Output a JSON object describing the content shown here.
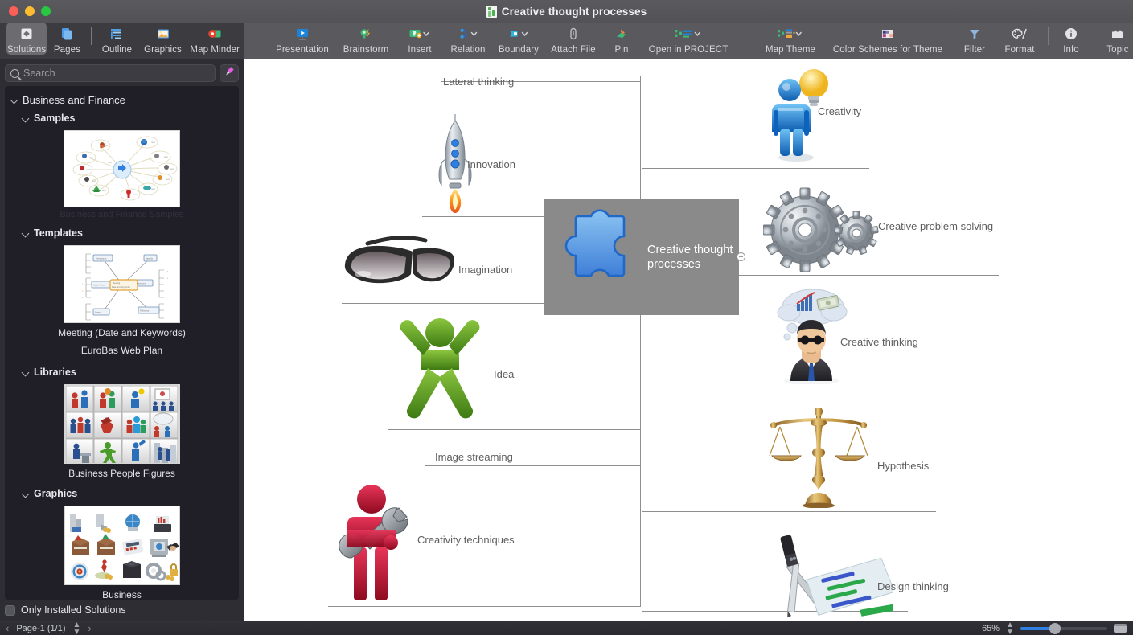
{
  "window": {
    "title": "Creative thought processes",
    "title_icon": "document-icon",
    "traffic_lights": [
      "close",
      "minimize",
      "zoom"
    ]
  },
  "toolbar": {
    "left_group": [
      {
        "label": "Solutions",
        "icon": "solutions-icon",
        "selected": true,
        "chevron": false
      },
      {
        "label": "Pages",
        "icon": "pages-icon",
        "selected": false,
        "chevron": false
      },
      {
        "label": "Outline",
        "icon": "outline-icon",
        "selected": false,
        "chevron": false
      },
      {
        "label": "Graphics",
        "icon": "graphics-icon",
        "selected": false,
        "chevron": false
      },
      {
        "label": "Map Minder",
        "icon": "map-minder-icon",
        "selected": false,
        "chevron": false
      }
    ],
    "right_group": [
      {
        "label": "Presentation",
        "icon": "presentation-icon",
        "chevron": false
      },
      {
        "label": "Brainstorm",
        "icon": "brainstorm-icon",
        "chevron": false
      },
      {
        "label": "Insert",
        "icon": "insert-icon",
        "chevron": true
      },
      {
        "label": "Relation",
        "icon": "relation-icon",
        "chevron": true
      },
      {
        "label": "Boundary",
        "icon": "boundary-icon",
        "chevron": true
      },
      {
        "label": "Attach File",
        "icon": "attach-file-icon",
        "chevron": false
      },
      {
        "label": "Pin",
        "icon": "pin-icon",
        "chevron": false
      },
      {
        "label": "Open in PROJECT",
        "icon": "open-in-project-icon",
        "chevron": true
      },
      {
        "label": "Map Theme",
        "icon": "map-theme-icon",
        "chevron": true
      },
      {
        "label": "Color Schemes for Theme",
        "icon": "color-schemes-icon",
        "chevron": false
      },
      {
        "label": "Filter",
        "icon": "filter-icon",
        "chevron": false
      },
      {
        "label": "Format",
        "icon": "format-icon",
        "chevron": false
      },
      {
        "label": "Info",
        "icon": "info-icon",
        "chevron": false
      },
      {
        "label": "Topic",
        "icon": "topic-icon",
        "chevron": false
      }
    ]
  },
  "sidebar": {
    "search": {
      "placeholder": "Search",
      "icon": "search-icon",
      "value": ""
    },
    "stamp_button_icon": "stamp-icon",
    "root": {
      "label": "Business and Finance",
      "expanded": true
    },
    "groups": [
      {
        "label": "Samples",
        "expanded": true,
        "items": [
          {
            "caption": "Business and Finance Samples",
            "thumbnail": "radial-mindmap-thumbnail"
          }
        ]
      },
      {
        "label": "Templates",
        "expanded": true,
        "items": [
          {
            "caption": "Meeting (Date and Keywords)",
            "thumbnail": "meeting-template-thumbnail"
          },
          {
            "caption": "EuroBas Web Plan",
            "thumbnail": null
          }
        ]
      },
      {
        "label": "Libraries",
        "expanded": true,
        "items": [
          {
            "caption": "Business People Figures",
            "thumbnail": "people-figures-grid-thumbnail"
          }
        ]
      },
      {
        "label": "Graphics",
        "expanded": true,
        "items": [
          {
            "caption": "Business",
            "thumbnail": "business-graphics-grid-thumbnail"
          }
        ]
      }
    ],
    "only_installed": {
      "label": "Only Installed Solutions",
      "checked": false
    }
  },
  "mindmap": {
    "central": {
      "text": "Creative thought\nprocesses",
      "icon": "puzzle-piece-icon",
      "fill": "#8a8a8a"
    },
    "left_branches": [
      {
        "label": "Lateral thinking",
        "icon": null
      },
      {
        "label": "Innovation",
        "icon": "rocket-icon"
      },
      {
        "label": "Imagination",
        "icon": "sunglasses-icon"
      },
      {
        "label": "Idea",
        "icon": "green-figure-icon"
      },
      {
        "label": "Image streaming",
        "icon": null
      },
      {
        "label": "Creativity techniques",
        "icon": "red-figure-wrench-icon"
      }
    ],
    "right_branches": [
      {
        "label": "Creativity",
        "icon": "blue-figure-lightbulb-icon"
      },
      {
        "label": "Creative problem solving",
        "icon": "gears-icon"
      },
      {
        "label": "Creative thinking",
        "icon": "businessman-thought-bubble-icon"
      },
      {
        "label": "Hypothesis",
        "icon": "balance-scale-icon"
      },
      {
        "label": "Design thinking",
        "icon": "compass-blueprint-icon"
      }
    ],
    "collapse_control_icon": "collapse-minus-icon"
  },
  "statusbar": {
    "prev_icon": "chevron-left-icon",
    "next_icon": "chevron-right-icon",
    "page_label": "Page-1 (1/1)",
    "stepper_icon": "stepper-updown-icon",
    "zoom_level": "65%",
    "zoom_stepper_icon": "stepper-updown-icon",
    "fit_icon": "fit-page-icon"
  },
  "colors": {
    "titlebar": "#555559",
    "toolbar": "#5a5a5e",
    "sidebar": "#2d2d33",
    "panel": "#201f28",
    "canvas": "#ffffff",
    "accent_blue": "#2f7fe0",
    "central_fill": "#8a8a8a",
    "connector": "#8e8e8e"
  }
}
